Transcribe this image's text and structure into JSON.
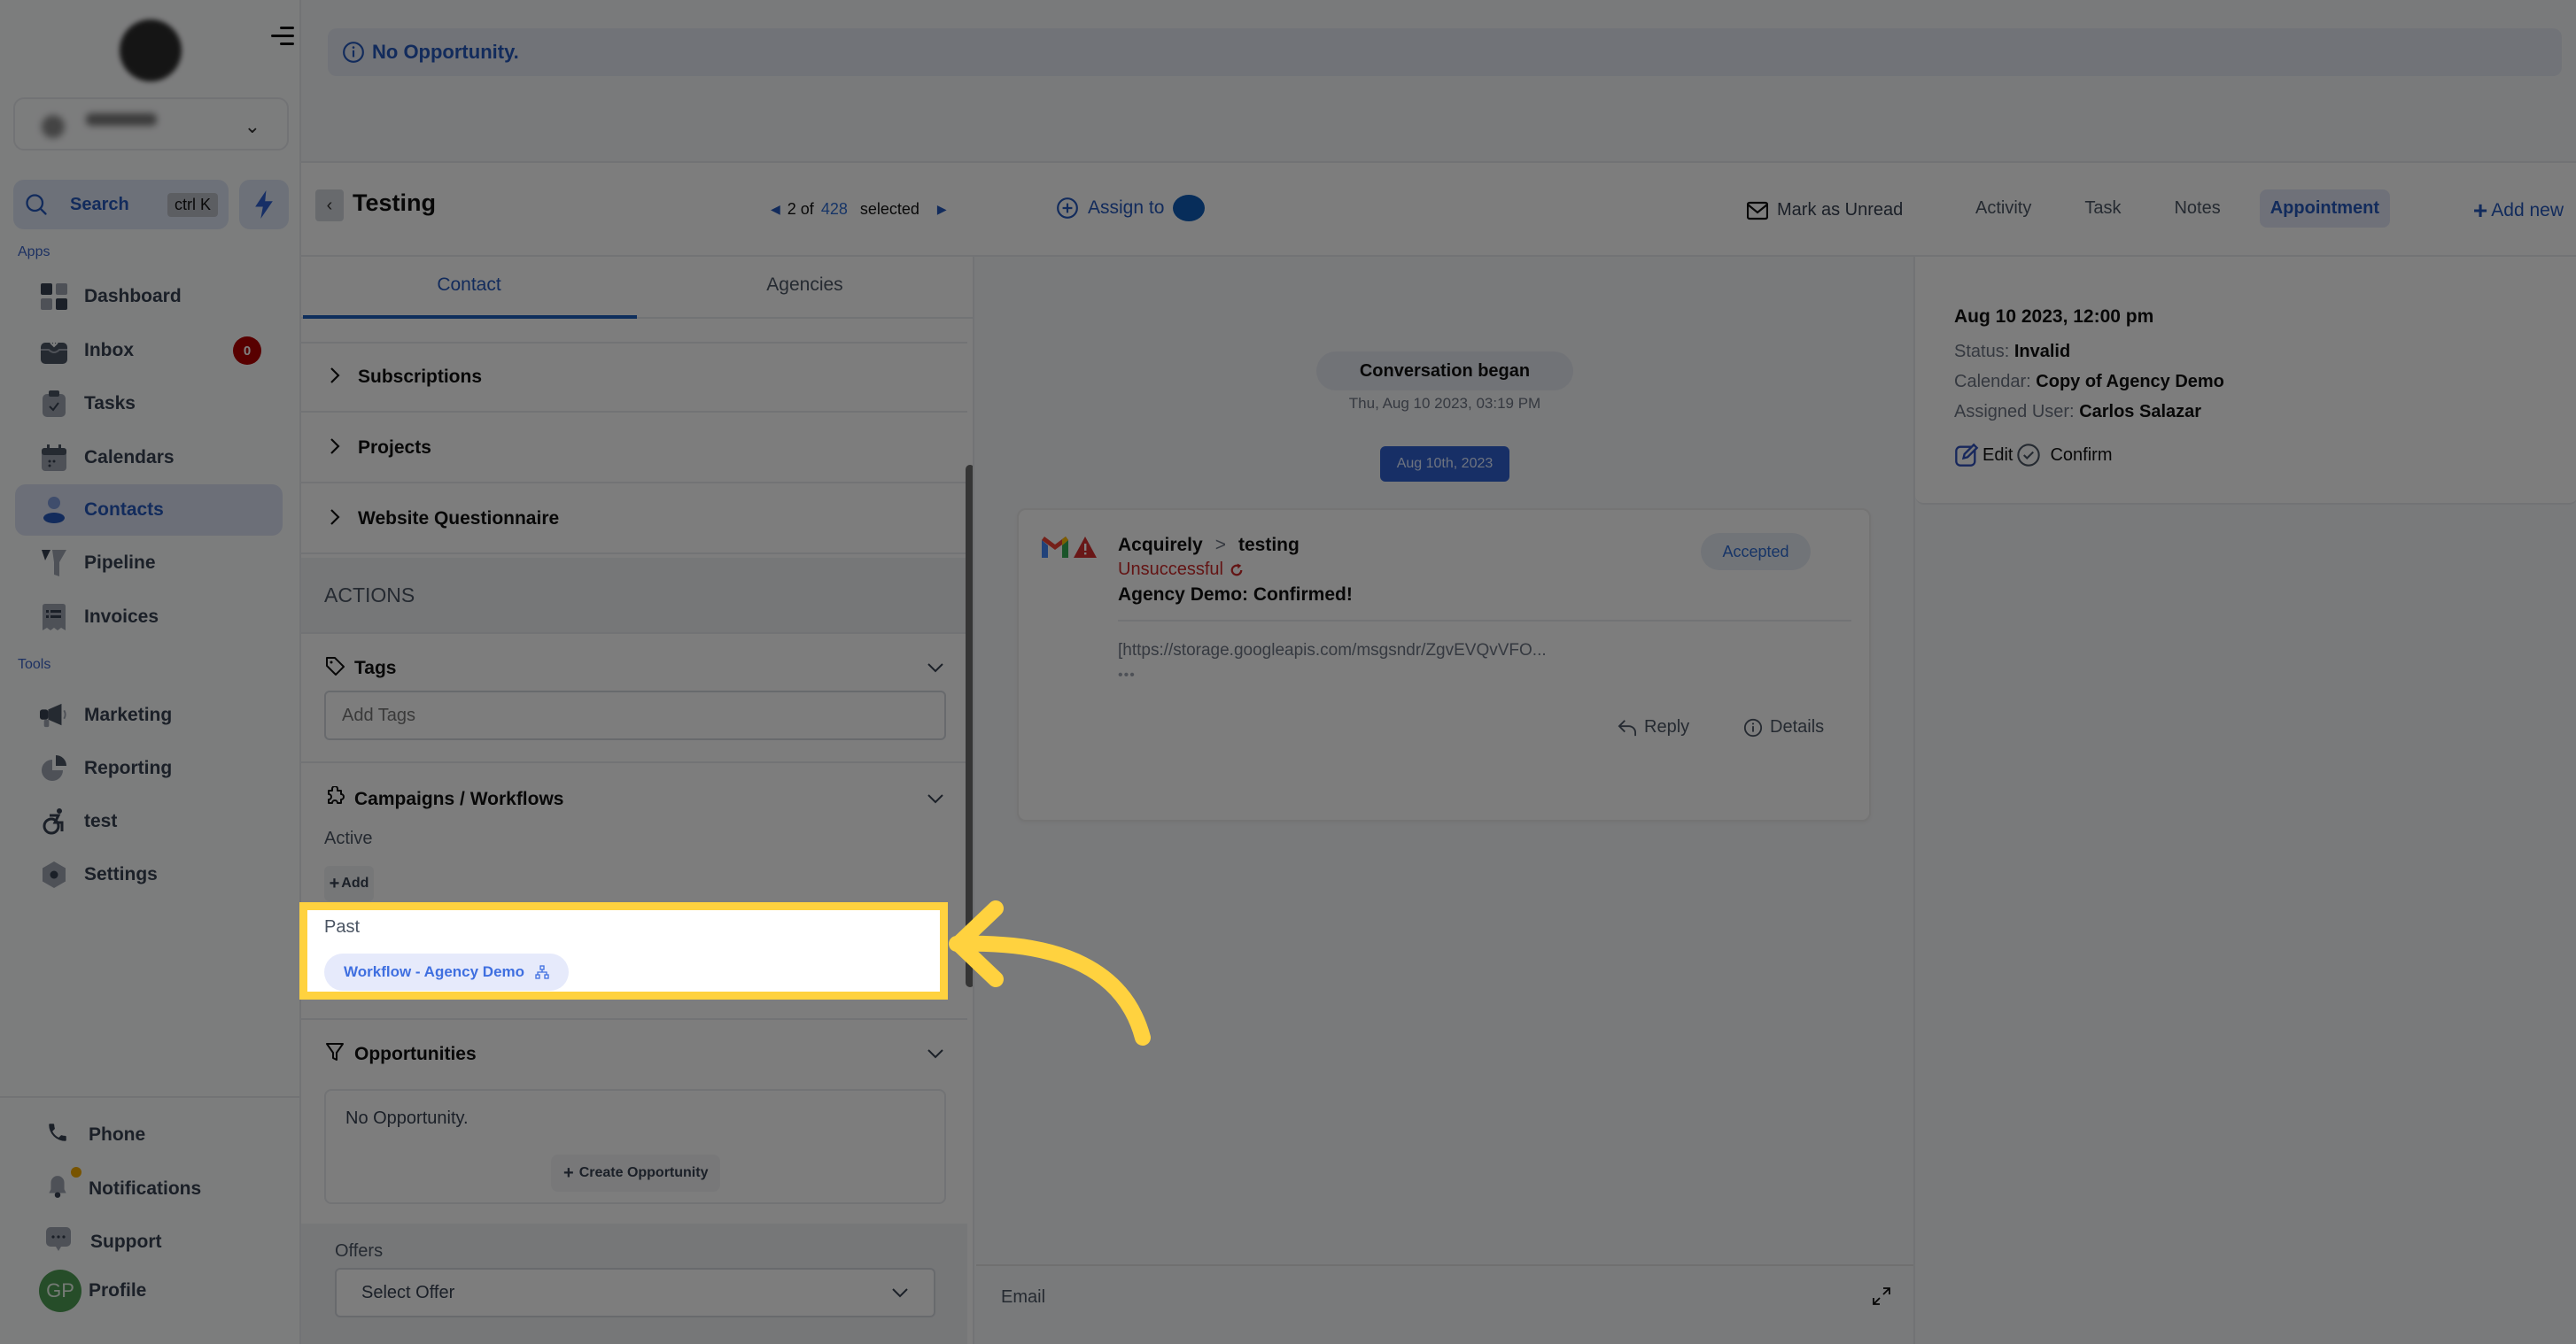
{
  "banner": {
    "icon": "info-icon",
    "text": "No Opportunity."
  },
  "sidebar": {
    "search": {
      "label": "Search",
      "shortcut": "ctrl K"
    },
    "apps_label": "Apps",
    "tools_label": "Tools",
    "apps": [
      {
        "label": "Dashboard",
        "icon": "dashboard-icon"
      },
      {
        "label": "Inbox",
        "icon": "inbox-icon",
        "badge": "0"
      },
      {
        "label": "Tasks",
        "icon": "tasks-icon"
      },
      {
        "label": "Calendars",
        "icon": "calendar-icon"
      },
      {
        "label": "Contacts",
        "icon": "contacts-icon",
        "active": true
      },
      {
        "label": "Pipeline",
        "icon": "pipeline-icon"
      },
      {
        "label": "Invoices",
        "icon": "invoices-icon"
      }
    ],
    "tools": [
      {
        "label": "Marketing",
        "icon": "megaphone-icon"
      },
      {
        "label": "Reporting",
        "icon": "pie-chart-icon"
      },
      {
        "label": "test",
        "icon": "accessibility-icon"
      },
      {
        "label": "Settings",
        "icon": "settings-icon"
      }
    ],
    "bottom": [
      {
        "label": "Phone",
        "icon": "phone-icon"
      },
      {
        "label": "Notifications",
        "icon": "bell-icon"
      },
      {
        "label": "Support",
        "icon": "chat-icon"
      },
      {
        "label": "Profile",
        "initials": "GP"
      }
    ]
  },
  "header": {
    "contact_name": "Testing",
    "pager": {
      "current": "2 of",
      "total": "428",
      "suffix": "selected"
    },
    "assign_label": "Assign to",
    "mark_unread": "Mark as Unread",
    "tabs": [
      "Activity",
      "Task",
      "Notes",
      "Appointment"
    ],
    "active_tab": "Appointment",
    "add_new": "Add new"
  },
  "left_panel": {
    "tabs": [
      "Contact",
      "Agencies"
    ],
    "active_tab": "Contact",
    "accordions": [
      "Subscriptions",
      "Projects",
      "Website Questionnaire"
    ],
    "actions_header": "ACTIONS",
    "tags": {
      "title": "Tags",
      "placeholder": "Add Tags"
    },
    "campaigns": {
      "title": "Campaigns / Workflows",
      "active_label": "Active",
      "add_label": "Add",
      "past_label": "Past",
      "past_items": [
        "Workflow - Agency Demo"
      ]
    },
    "opportunities": {
      "title": "Opportunities",
      "empty_text": "No Opportunity.",
      "create_label": "Create Opportunity"
    },
    "offers": {
      "label": "Offers",
      "select_placeholder": "Select Offer"
    }
  },
  "conversation": {
    "began_label": "Conversation began",
    "began_time": "Thu, Aug 10 2023, 03:19 PM",
    "date_divider": "Aug 10th, 2023",
    "message": {
      "from": "Acquirely",
      "separator": ">",
      "to": "testing",
      "status": "Unsuccessful",
      "subject": "Agency Demo: Confirmed!",
      "body": "[https://storage.googleapis.com/msgsndr/ZgvEVQvVFO...",
      "more": "•••",
      "badge": "Accepted",
      "reply_label": "Reply",
      "details_label": "Details"
    },
    "compose_channel": "Email"
  },
  "appointment": {
    "datetime": "Aug 10 2023, 12:00 pm",
    "status_label": "Status:",
    "status_value": "Invalid",
    "calendar_label": "Calendar:",
    "calendar_value": "Copy of Agency Demo",
    "user_label": "Assigned User:",
    "user_value": "Carlos Salazar",
    "edit_label": "Edit",
    "confirm_label": "Confirm"
  },
  "colors": {
    "accent": "#2456b8",
    "highlight": "#ffd23f",
    "error": "#c62828",
    "badge_red": "#b00000"
  }
}
